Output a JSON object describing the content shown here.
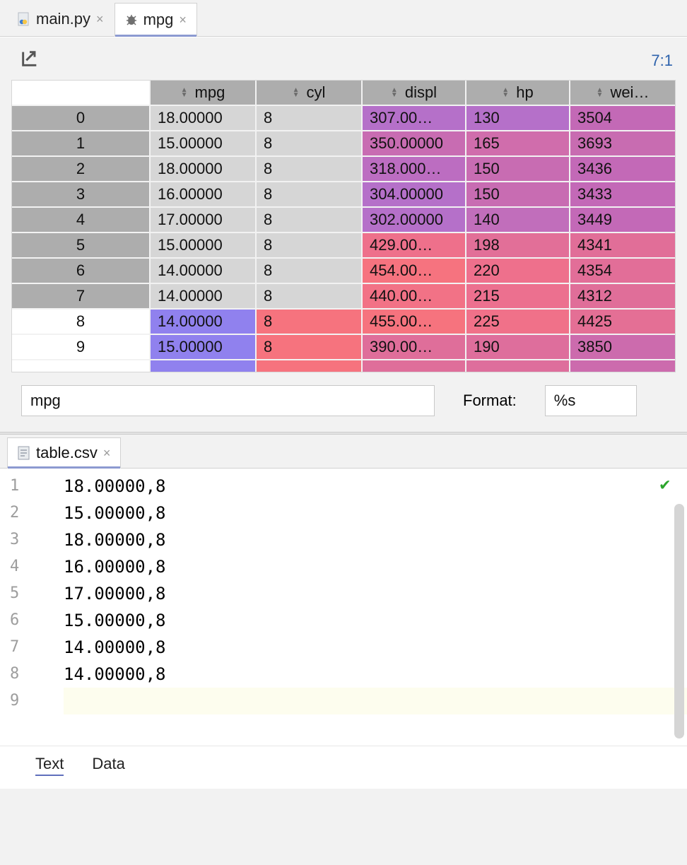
{
  "tabs": [
    {
      "label": "main.py",
      "active": false,
      "icon": "python"
    },
    {
      "label": "mpg",
      "active": true,
      "icon": "debug"
    }
  ],
  "cursor_position": "7:1",
  "table": {
    "columns": [
      "mpg",
      "cyl",
      "displ",
      "hp",
      "wei…"
    ],
    "rows": [
      {
        "idx": "0",
        "mpg": "18.00000",
        "cyl": "8",
        "displ": "307.00…",
        "hp": "130",
        "wei": "3504",
        "idx_sel": true,
        "mpg_bg": "#d6d6d6",
        "cyl_bg": "#d6d6d6",
        "displ_bg": "#b570c9",
        "hp_bg": "#b570c9",
        "wei_bg": "#c369b6"
      },
      {
        "idx": "1",
        "mpg": "15.00000",
        "cyl": "8",
        "displ": "350.00000",
        "hp": "165",
        "wei": "3693",
        "idx_sel": true,
        "mpg_bg": "#d6d6d6",
        "cyl_bg": "#d6d6d6",
        "displ_bg": "#c86cb2",
        "hp_bg": "#d06dac",
        "wei_bg": "#c86cb1"
      },
      {
        "idx": "2",
        "mpg": "18.00000",
        "cyl": "8",
        "displ": "318.000…",
        "hp": "150",
        "wei": "3436",
        "idx_sel": true,
        "mpg_bg": "#d6d6d6",
        "cyl_bg": "#d6d6d6",
        "displ_bg": "#bc6dc1",
        "hp_bg": "#c86cb2",
        "wei_bg": "#c369b7"
      },
      {
        "idx": "3",
        "mpg": "16.00000",
        "cyl": "8",
        "displ": "304.00000",
        "hp": "150",
        "wei": "3433",
        "idx_sel": true,
        "mpg_bg": "#d6d6d6",
        "cyl_bg": "#d6d6d6",
        "displ_bg": "#b570c9",
        "hp_bg": "#c86cb2",
        "wei_bg": "#c369b7"
      },
      {
        "idx": "4",
        "mpg": "17.00000",
        "cyl": "8",
        "displ": "302.00000",
        "hp": "140",
        "wei": "3449",
        "idx_sel": true,
        "mpg_bg": "#d6d6d6",
        "cyl_bg": "#d6d6d6",
        "displ_bg": "#b570c9",
        "hp_bg": "#c16ebb",
        "wei_bg": "#c369b7"
      },
      {
        "idx": "5",
        "mpg": "15.00000",
        "cyl": "8",
        "displ": "429.00…",
        "hp": "198",
        "wei": "4341",
        "idx_sel": true,
        "mpg_bg": "#d6d6d6",
        "cyl_bg": "#d6d6d6",
        "displ_bg": "#ee708b",
        "hp_bg": "#e26f98",
        "wei_bg": "#e16e98"
      },
      {
        "idx": "6",
        "mpg": "14.00000",
        "cyl": "8",
        "displ": "454.00…",
        "hp": "220",
        "wei": "4354",
        "idx_sel": true,
        "mpg_bg": "#d6d6d6",
        "cyl_bg": "#d6d6d6",
        "displ_bg": "#f6737f",
        "hp_bg": "#ee708c",
        "wei_bg": "#e26e98"
      },
      {
        "idx": "7",
        "mpg": "14.00000",
        "cyl": "8",
        "displ": "440.00…",
        "hp": "215",
        "wei": "4312",
        "idx_sel": true,
        "mpg_bg": "#d6d6d6",
        "cyl_bg": "#d6d6d6",
        "displ_bg": "#f27286",
        "hp_bg": "#ec708f",
        "wei_bg": "#e06e99"
      },
      {
        "idx": "8",
        "mpg": "14.00000",
        "cyl": "8",
        "displ": "455.00…",
        "hp": "225",
        "wei": "4425",
        "idx_sel": false,
        "mpg_bg": "#9081ee",
        "cyl_bg": "#f6737e",
        "displ_bg": "#f6737e",
        "hp_bg": "#f07189",
        "wei_bg": "#e46f95"
      },
      {
        "idx": "9",
        "mpg": "15.00000",
        "cyl": "8",
        "displ": "390.00…",
        "hp": "190",
        "wei": "3850",
        "idx_sel": false,
        "mpg_bg": "#9081ee",
        "cyl_bg": "#f6737e",
        "displ_bg": "#df6e9a",
        "hp_bg": "#de6e9c",
        "wei_bg": "#cc6bad"
      }
    ],
    "partial_row": {
      "present": true
    }
  },
  "filter_value": "mpg",
  "format_label": "Format:",
  "format_value": "%s",
  "csv_tab": {
    "label": "table.csv"
  },
  "csv_lines": [
    "18.00000,8",
    "15.00000,8",
    "18.00000,8",
    "16.00000,8",
    "17.00000,8",
    "15.00000,8",
    "14.00000,8",
    "14.00000,8"
  ],
  "gutter": [
    "1",
    "2",
    "3",
    "4",
    "5",
    "6",
    "7",
    "8",
    "9"
  ],
  "view_tabs": {
    "text": "Text",
    "data": "Data"
  }
}
